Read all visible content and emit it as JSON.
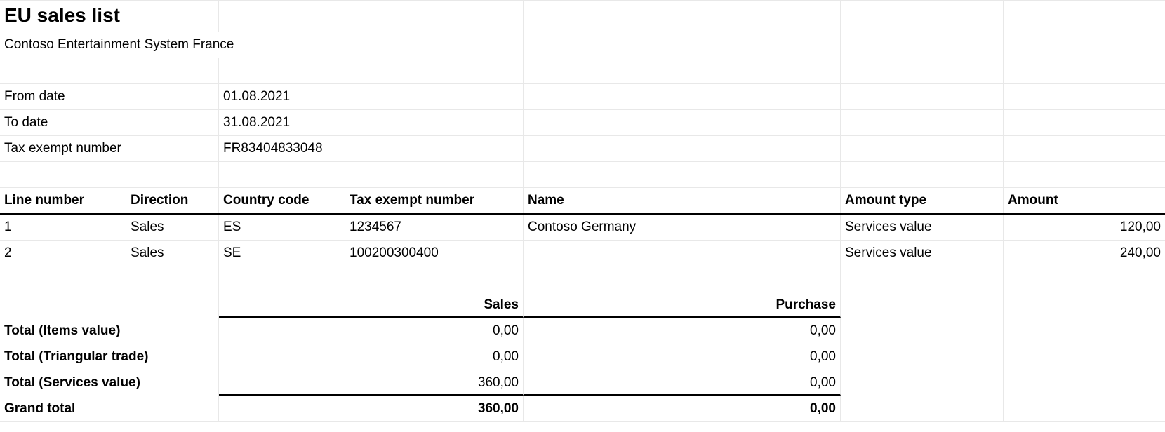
{
  "report": {
    "title": "EU sales list",
    "company": "Contoso Entertainment System France",
    "fields": {
      "from_date_label": "From date",
      "from_date": "01.08.2021",
      "to_date_label": "To date",
      "to_date": "31.08.2021",
      "tax_exempt_label": "Tax exempt number",
      "tax_exempt": "FR83404833048"
    }
  },
  "columns": {
    "line_number": "Line number",
    "direction": "Direction",
    "country_code": "Country code",
    "tax_exempt_number": "Tax exempt number",
    "name": "Name",
    "amount_type": "Amount type",
    "amount": "Amount"
  },
  "lines": [
    {
      "num": "1",
      "direction": "Sales",
      "country": "ES",
      "tax_exempt": "1234567",
      "name": "Contoso Germany",
      "amount_type": "Services value",
      "amount": "120,00"
    },
    {
      "num": "2",
      "direction": "Sales",
      "country": "SE",
      "tax_exempt": "100200300400",
      "name": "",
      "amount_type": "Services value",
      "amount": "240,00"
    }
  ],
  "totals": {
    "header_sales": "Sales",
    "header_purchase": "Purchase",
    "rows": [
      {
        "label": "Total (Items value)",
        "sales": "0,00",
        "purchase": "0,00"
      },
      {
        "label": "Total (Triangular trade)",
        "sales": "0,00",
        "purchase": "0,00"
      },
      {
        "label": "Total (Services value)",
        "sales": "360,00",
        "purchase": "0,00"
      }
    ],
    "grand_label": "Grand total",
    "grand_sales": "360,00",
    "grand_purchase": "0,00"
  }
}
